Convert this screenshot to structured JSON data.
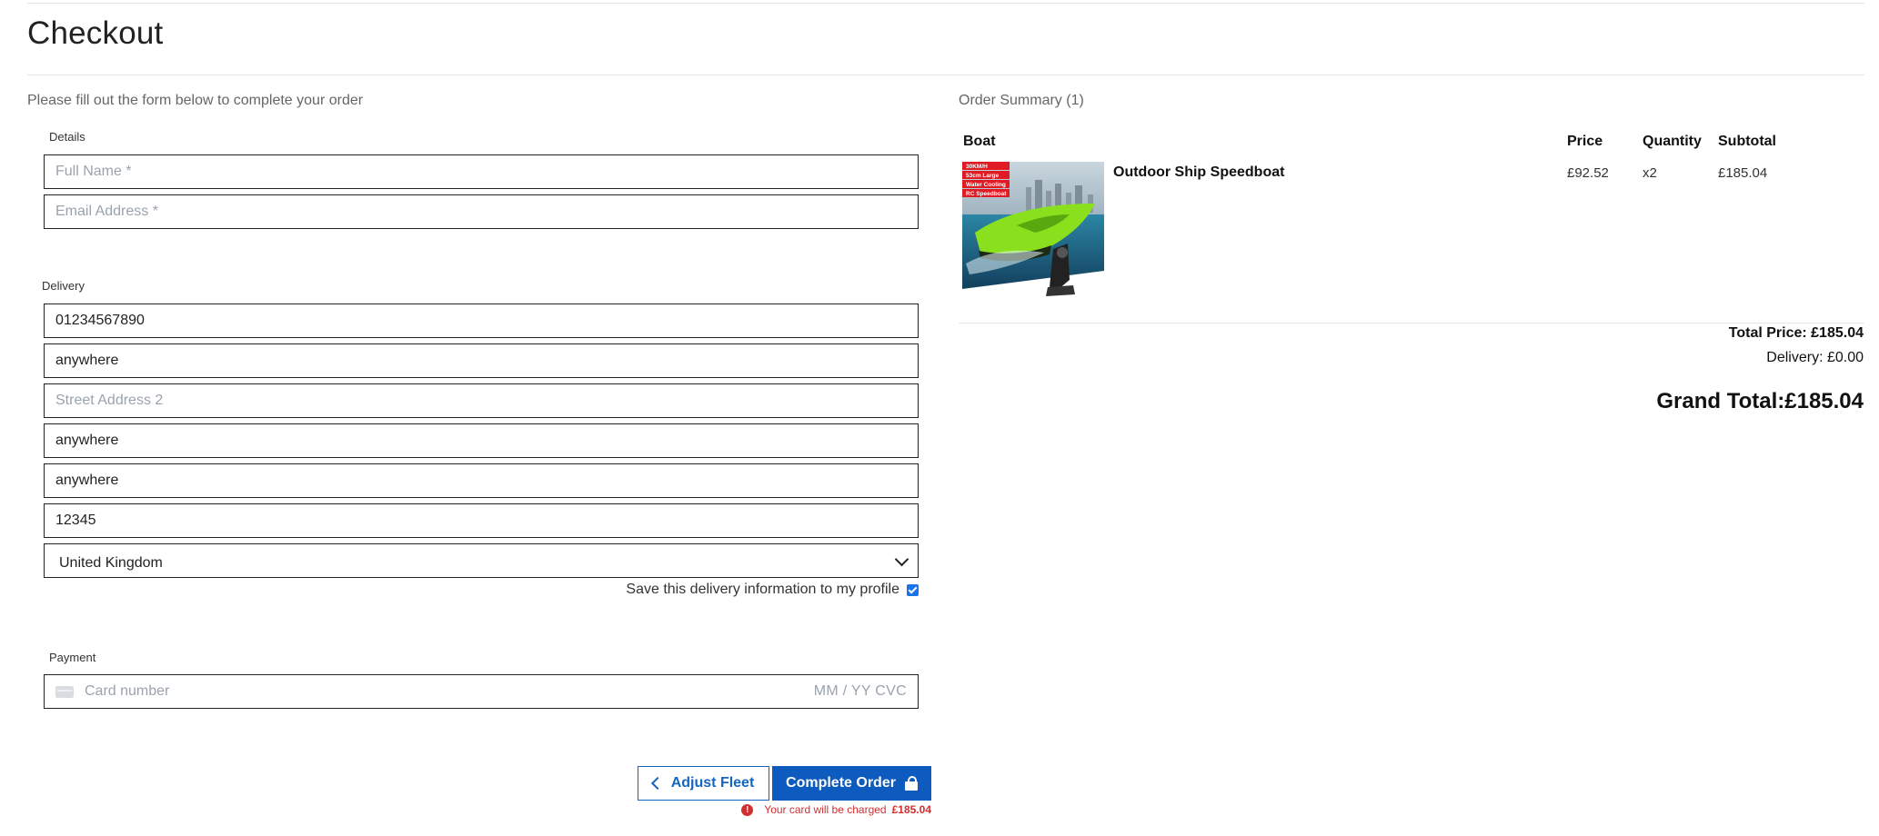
{
  "page": {
    "title": "Checkout",
    "intro": "Please fill out the form below to complete your order"
  },
  "details": {
    "label": "Details",
    "full_name_placeholder": "Full Name *",
    "email_placeholder": "Email Address *"
  },
  "delivery": {
    "label": "Delivery",
    "phone_value": "01234567890",
    "street1_value": "anywhere",
    "street2_placeholder": "Street Address 2",
    "town_value": "anywhere",
    "county_value": "anywhere",
    "postcode_value": "12345",
    "country_value": "United Kingdom",
    "save_label": "Save this delivery information to my profile",
    "save_checked": true
  },
  "payment": {
    "label": "Payment",
    "card_placeholder": "Card number",
    "expiry_cvc_placeholder": "MM / YY  CVC"
  },
  "actions": {
    "adjust_label": "Adjust Fleet",
    "complete_label": "Complete Order",
    "charge_text": "Your card will be charged",
    "charge_amount": "£185.04"
  },
  "summary": {
    "heading": "Order Summary (1)",
    "columns": [
      "Boat",
      "Price",
      "Quantity",
      "Subtotal"
    ],
    "items": [
      {
        "name": "Outdoor Ship Speedboat",
        "price": "£92.52",
        "quantity": "x2",
        "subtotal": "£185.04",
        "image_badges": [
          "30KM/H",
          "53cm Large",
          "Water Cooling",
          "RC Speedboat"
        ]
      }
    ],
    "total_price": "Total Price: £185.04",
    "delivery": "Delivery: £0.00",
    "grand_total": "Grand Total:£185.04"
  },
  "colors": {
    "primary": "#0d5bbf",
    "error": "#d32f2f",
    "boat_green": "#8be01e"
  }
}
